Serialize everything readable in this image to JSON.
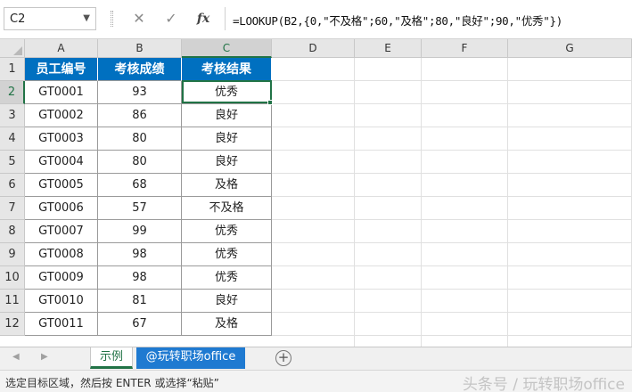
{
  "name_box": {
    "value": "C2"
  },
  "formula_bar": {
    "cancel_icon": "✕",
    "confirm_icon": "✓",
    "fx_label": "fx",
    "formula": "=LOOKUP(B2,{0,\"不及格\";60,\"及格\";80,\"良好\";90,\"优秀\"})"
  },
  "columns": [
    "A",
    "B",
    "C",
    "D",
    "E",
    "F",
    "G"
  ],
  "row_numbers": [
    "1",
    "2",
    "3",
    "4",
    "5",
    "6",
    "7",
    "8",
    "9",
    "10",
    "11",
    "12"
  ],
  "table": {
    "headers": [
      "员工编号",
      "考核成绩",
      "考核结果"
    ],
    "rows": [
      [
        "GT0001",
        "93",
        "优秀"
      ],
      [
        "GT0002",
        "86",
        "良好"
      ],
      [
        "GT0003",
        "80",
        "良好"
      ],
      [
        "GT0004",
        "80",
        "良好"
      ],
      [
        "GT0005",
        "68",
        "及格"
      ],
      [
        "GT0006",
        "57",
        "不及格"
      ],
      [
        "GT0007",
        "99",
        "优秀"
      ],
      [
        "GT0008",
        "98",
        "优秀"
      ],
      [
        "GT0009",
        "98",
        "优秀"
      ],
      [
        "GT0010",
        "81",
        "良好"
      ],
      [
        "GT0011",
        "67",
        "及格"
      ]
    ]
  },
  "sheet_tabs": {
    "active": "示例",
    "second": "@玩转职场office",
    "add_icon": "+"
  },
  "status_bar": {
    "message": "选定目标区域，然后按 ENTER 或选择“粘贴”"
  },
  "watermark": {
    "text": "头条号 / 玩转职场office"
  },
  "colors": {
    "header_fill": "#0070c0",
    "selection": "#217346",
    "tab_blue": "#1f7ad1"
  }
}
